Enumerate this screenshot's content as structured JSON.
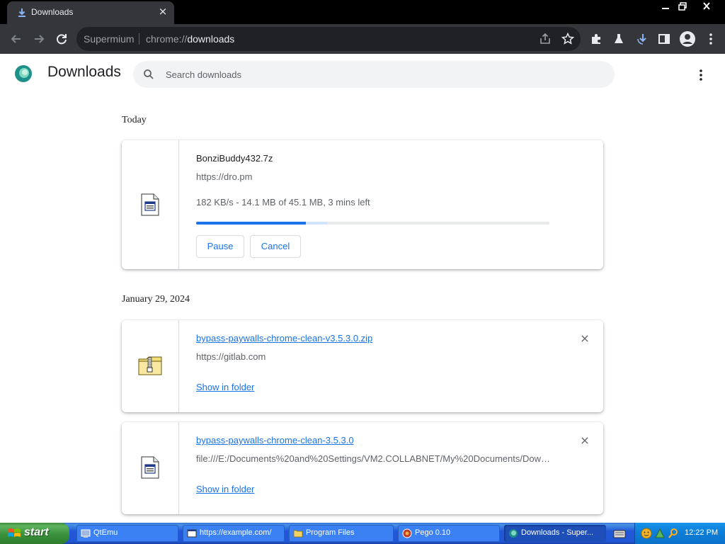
{
  "browser": {
    "tab_title": "Downloads",
    "tab_close": "×",
    "site_label": "Supermium",
    "url_scheme": "chrome://",
    "url_path": "downloads"
  },
  "page": {
    "title": "Downloads",
    "search_placeholder": "Search downloads"
  },
  "sections": [
    {
      "label": "Today",
      "items": [
        {
          "file_name": "BonziBuddy432.7z",
          "source": "https://dro.pm",
          "status": "182 KB/s - 14.1 MB of 45.1 MB, 3 mins left",
          "progress": 0.31,
          "buffered": 0.37,
          "pause_label": "Pause",
          "cancel_label": "Cancel",
          "icon": "generic-file-icon"
        }
      ]
    },
    {
      "label": "January 29, 2024",
      "items": [
        {
          "file_name": "bypass-paywalls-chrome-clean-v3.5.3.0.zip",
          "source": "https://gitlab.com",
          "action_label": "Show in folder",
          "remove": "×",
          "icon": "zip-folder-icon"
        },
        {
          "file_name": "bypass-paywalls-chrome-clean-3.5.3.0",
          "source": "file:///E:/Documents%20and%20Settings/VM2.COLLABNET/My%20Documents/Down...",
          "action_label": "Show in folder",
          "remove": "×",
          "icon": "generic-file-icon"
        }
      ]
    }
  ],
  "taskbar": {
    "start_label": "start",
    "items": [
      {
        "label": "QtEmu",
        "icon": "qtemu-icon",
        "active": false
      },
      {
        "label": "https://example.com/",
        "icon": "window-icon",
        "active": false
      },
      {
        "label": "Program Files",
        "icon": "folder-icon",
        "active": false
      },
      {
        "label": "Pego 0.10",
        "icon": "pego-icon",
        "active": false
      },
      {
        "label": "Downloads - Super...",
        "icon": "supermium-icon",
        "active": true
      }
    ],
    "clock": "12:22 PM"
  },
  "colors": {
    "accent": "#1a73e8",
    "frame": "#35363a",
    "titlebar": "#000000"
  }
}
